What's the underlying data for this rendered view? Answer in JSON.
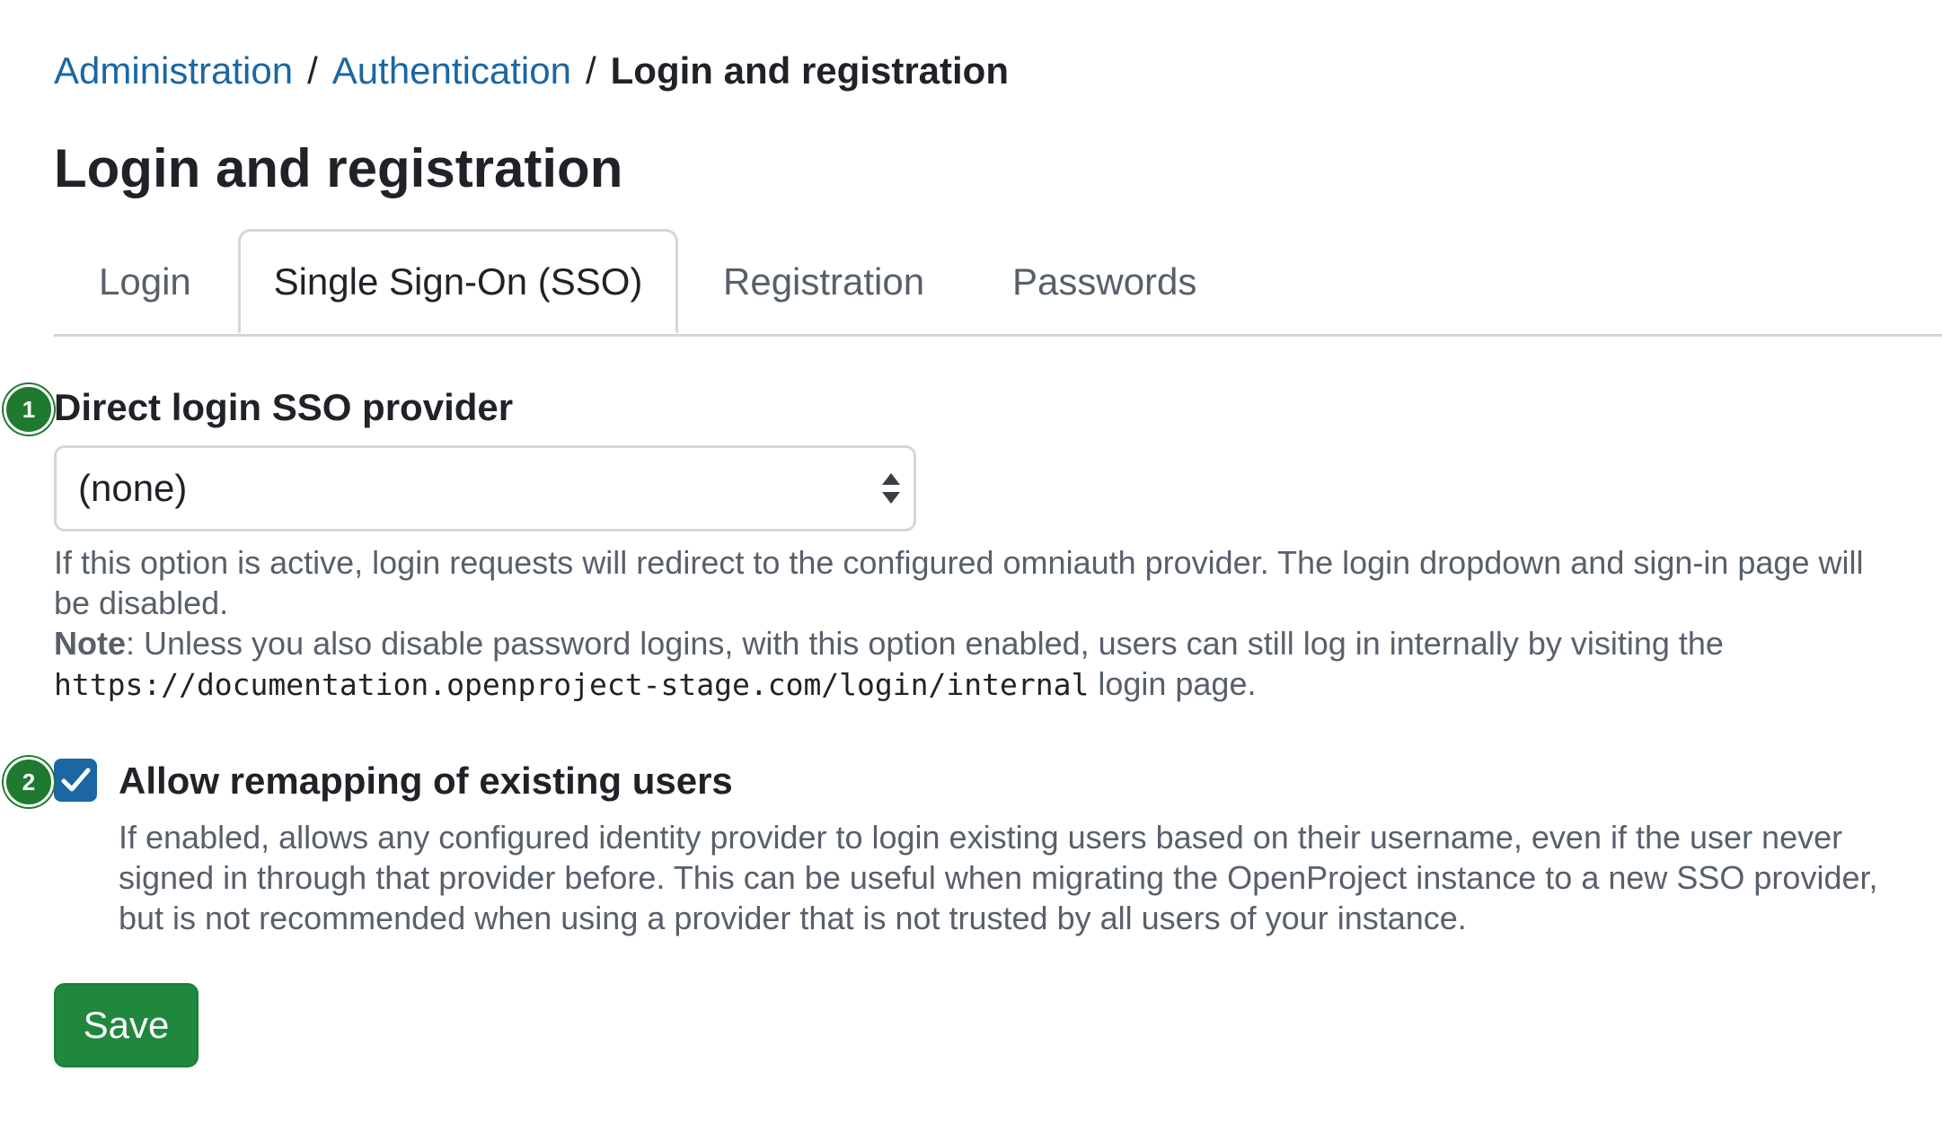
{
  "breadcrumb": {
    "items": [
      {
        "label": "Administration"
      },
      {
        "label": "Authentication"
      }
    ],
    "separator": "/",
    "current": "Login and registration"
  },
  "page": {
    "title": "Login and registration"
  },
  "tabs": [
    {
      "label": "Login",
      "active": false
    },
    {
      "label": "Single Sign-On (SSO)",
      "active": true
    },
    {
      "label": "Registration",
      "active": false
    },
    {
      "label": "Passwords",
      "active": false
    }
  ],
  "markers": {
    "first": "1",
    "second": "2"
  },
  "sso_provider": {
    "label": "Direct login SSO provider",
    "selected_value": "(none)",
    "help": "If this option is active, login requests will redirect to the configured omniauth provider. The login dropdown and sign-in page will be disabled.",
    "note_label": "Note",
    "note_text": ": Unless you also disable password logins, with this option enabled, users can still log in internally by visiting the ",
    "note_url": "https://documentation.openproject-stage.com/login/internal",
    "note_suffix": " login page."
  },
  "remapping": {
    "label": "Allow remapping of existing users",
    "checked": true,
    "help": "If enabled, allows any configured identity provider to login existing users based on their username, even if the user never signed in through that provider before. This can be useful when migrating the OpenProject instance to a new SSO provider, but is not recommended when using a provider that is not trusted by all users of your instance."
  },
  "actions": {
    "save_label": "Save"
  },
  "colors": {
    "link": "#1a67a3",
    "primary_button": "#1f883d",
    "marker": "#1f7a30",
    "checkbox": "#1a67a3",
    "muted_text": "#57606a"
  },
  "icons": {
    "select_arrows": "sort-arrows-icon",
    "checkbox_check": "checkmark-icon"
  }
}
